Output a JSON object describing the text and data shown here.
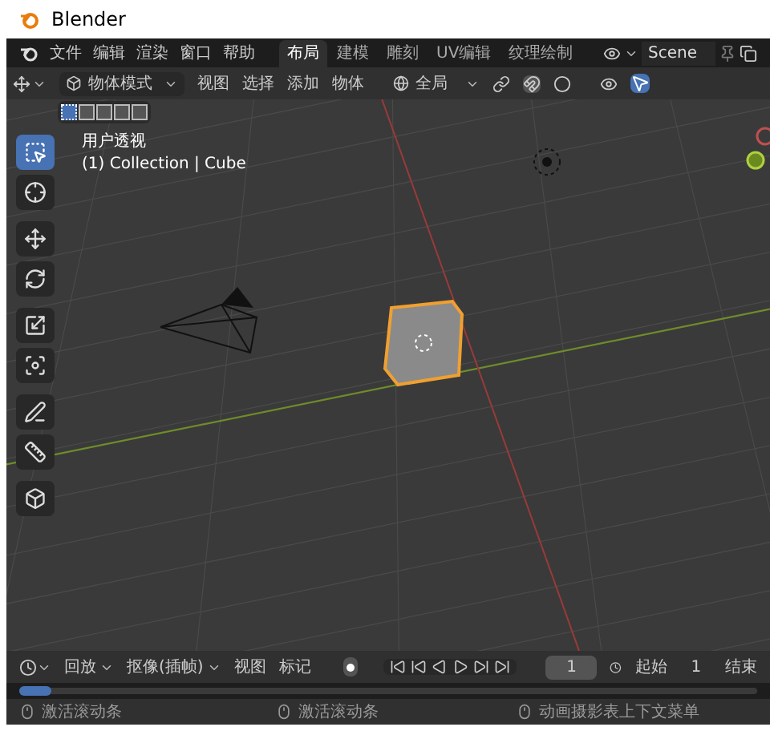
{
  "window": {
    "title": "Blender"
  },
  "menu": [
    "文件",
    "编辑",
    "渲染",
    "窗口",
    "帮助"
  ],
  "workspace_tabs": [
    {
      "label": "布局",
      "selected": true
    },
    {
      "label": "建模",
      "selected": false
    },
    {
      "label": "雕刻",
      "selected": false
    },
    {
      "label": "UV编辑",
      "selected": false
    },
    {
      "label": "纹理绘制",
      "selected": false
    }
  ],
  "scene": {
    "value": "Scene"
  },
  "header": {
    "mode": "物体模式",
    "menus": [
      "视图",
      "选择",
      "添加",
      "物体"
    ],
    "orientation": "全局"
  },
  "select_modes": [
    {
      "selected": true
    },
    {
      "selected": false
    },
    {
      "selected": false
    },
    {
      "selected": false
    },
    {
      "selected": false
    }
  ],
  "viewport": {
    "view_name": "用户透视",
    "collection": "(1) Collection | Cube"
  },
  "tools": [
    {
      "kind": "select",
      "selected": true
    },
    {
      "kind": "cursor",
      "selected": false
    },
    {
      "kind": "move",
      "selected": false
    },
    {
      "kind": "rotate",
      "selected": false
    },
    {
      "kind": "scale",
      "selected": false
    },
    {
      "kind": "transform",
      "selected": false
    },
    {
      "kind": "annotate",
      "selected": false
    },
    {
      "kind": "measure",
      "selected": false
    },
    {
      "kind": "add_cube",
      "selected": false
    }
  ],
  "timeline": {
    "menus": [
      "回放",
      "抠像(插帧)",
      "视图",
      "标记"
    ],
    "current_frame": "1",
    "start_label": "起始",
    "start": "1",
    "end_label": "结束"
  },
  "status_bar": [
    "激活滚动条",
    "激活滚动条",
    "动画摄影表上下文菜单"
  ]
}
